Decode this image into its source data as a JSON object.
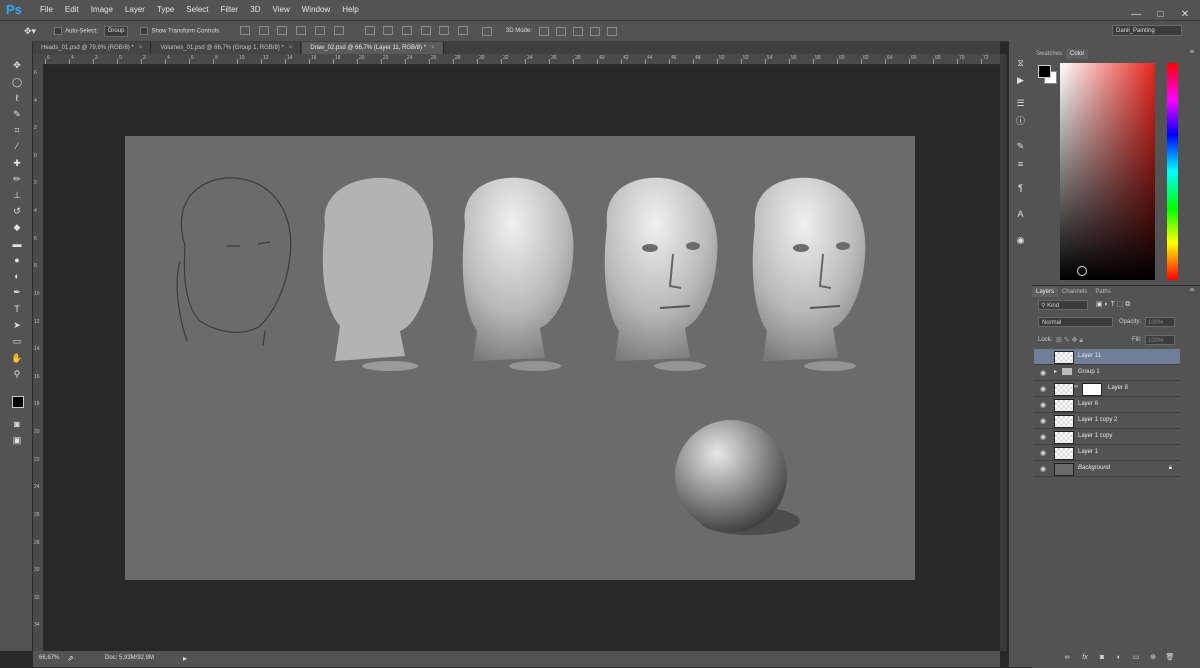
{
  "app": {
    "logo": "Ps"
  },
  "menu": [
    "File",
    "Edit",
    "Image",
    "Layer",
    "Type",
    "Select",
    "Filter",
    "3D",
    "View",
    "Window",
    "Help"
  ],
  "window_controls": {
    "minimize": "—",
    "restore": "□",
    "close": "✕"
  },
  "options_bar": {
    "auto_select_label": "Auto-Select:",
    "auto_select_value": "Group",
    "show_transform_label": "Show Transform Controls",
    "mode_3d_label": "3D Mode:",
    "workspace": "Danil_Painting"
  },
  "tabs": [
    {
      "label": "Heads_01.psd @ 79,6% (RGB/8) *"
    },
    {
      "label": "Volumes_01.psd @ 66,7% (Group 1, RGB/8) *"
    },
    {
      "label": "Draw_02.psd @ 66,7% (Layer 11, RGB/8) *"
    }
  ],
  "ruler_top": [
    "6",
    "4",
    "2",
    "0",
    "2",
    "4",
    "6",
    "8",
    "10",
    "12",
    "14",
    "16",
    "18",
    "20",
    "22",
    "24",
    "26",
    "28",
    "30",
    "32",
    "34",
    "36",
    "38",
    "40",
    "42",
    "44",
    "46",
    "48",
    "50",
    "52",
    "54",
    "56",
    "58",
    "60",
    "62",
    "64",
    "66",
    "68",
    "70",
    "72"
  ],
  "ruler_left": [
    "6",
    "4",
    "2",
    "0",
    "2",
    "4",
    "6",
    "8",
    "10",
    "12",
    "14",
    "16",
    "18",
    "20",
    "22",
    "24",
    "26",
    "28",
    "30",
    "32",
    "34"
  ],
  "status": {
    "zoom": "66,67%",
    "doc": "Doc: 5,93M/92,8M"
  },
  "color_panel": {
    "tabs": [
      "Swatches",
      "Color"
    ],
    "fg": "#000000",
    "bg": "#ffffff"
  },
  "layers_panel": {
    "tabs": [
      "Layers",
      "Channels",
      "Paths"
    ],
    "kind_label": "Kind",
    "blend_mode": "Normal",
    "opacity_label": "Opacity:",
    "opacity_value": "100%",
    "lock_label": "Lock:",
    "fill_label": "Fill:",
    "fill_value": "100%",
    "layers": [
      {
        "name": "Layer 11",
        "visible": false,
        "selected": true
      },
      {
        "name": "Group 1",
        "visible": true,
        "group": true
      },
      {
        "name": "Layer 8",
        "visible": true,
        "mask": true
      },
      {
        "name": "Layer 6",
        "visible": true
      },
      {
        "name": "Layer 1 copy 2",
        "visible": true
      },
      {
        "name": "Layer 1 copy",
        "visible": true
      },
      {
        "name": "Layer 1",
        "visible": true
      },
      {
        "name": "Background",
        "visible": true,
        "locked": true
      }
    ],
    "bottom_buttons": [
      "link-icon",
      "fx-icon",
      "mask-icon",
      "adjustment-icon",
      "folder-icon",
      "new-layer-icon",
      "trash-icon"
    ]
  }
}
